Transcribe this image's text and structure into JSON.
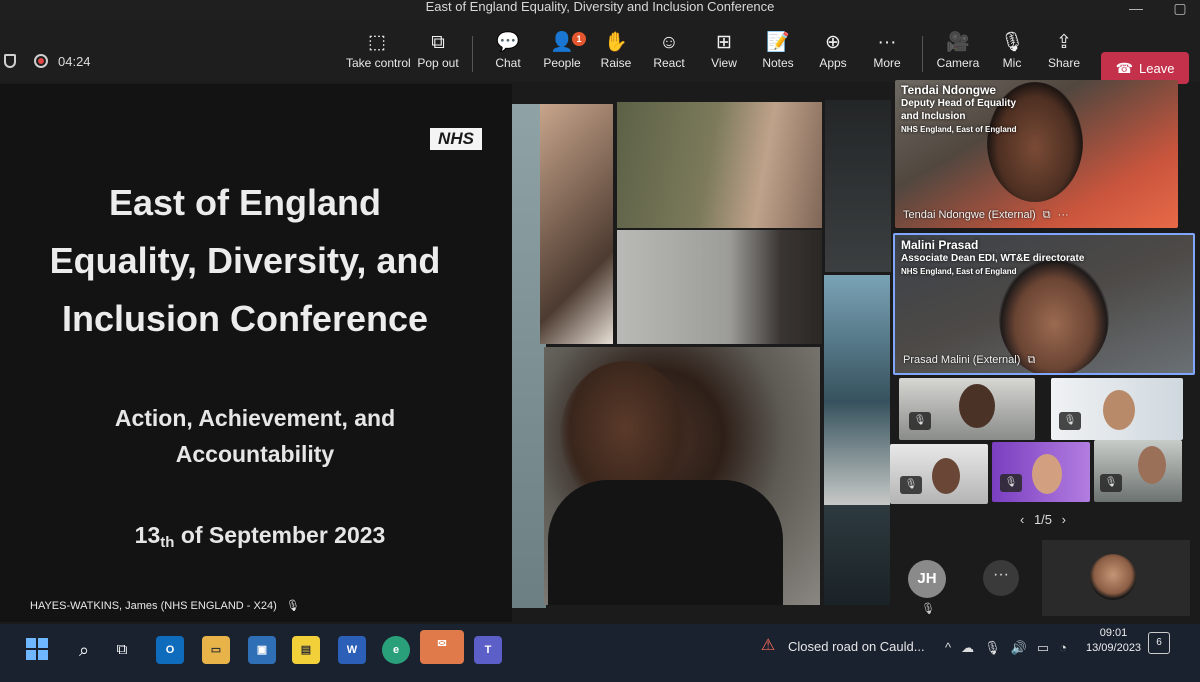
{
  "window": {
    "title": "East of England Equality, Diversity and Inclusion Conference"
  },
  "toolbar": {
    "timer": "04:24",
    "buttons": [
      {
        "label": "Take control",
        "icon": "take-control-icon"
      },
      {
        "label": "Pop out",
        "icon": "pop-out-icon"
      },
      {
        "label": "Chat",
        "icon": "chat-icon"
      },
      {
        "label": "People",
        "icon": "people-icon",
        "badge": "1"
      },
      {
        "label": "Raise",
        "icon": "raise-hand-icon"
      },
      {
        "label": "React",
        "icon": "react-icon"
      },
      {
        "label": "View",
        "icon": "view-icon"
      },
      {
        "label": "Notes",
        "icon": "notes-icon"
      },
      {
        "label": "Apps",
        "icon": "apps-icon"
      },
      {
        "label": "More",
        "icon": "more-icon"
      },
      {
        "label": "Camera",
        "icon": "camera-off-icon"
      },
      {
        "label": "Mic",
        "icon": "mic-off-icon"
      },
      {
        "label": "Share",
        "icon": "share-icon"
      }
    ],
    "leave_label": "Leave"
  },
  "slide": {
    "logo": "NHS",
    "title_lines": [
      "East of England",
      "Equality, Diversity, and",
      "Inclusion Conference"
    ],
    "subtitle_lines": [
      "Action, Achievement, and",
      "Accountability"
    ],
    "date_day": "13",
    "date_suffix": "th",
    "date_rest": "of September 2023",
    "presenter_name": "HAYES-WATKINS, James (NHS ENGLAND - X24)"
  },
  "participants": {
    "tendai": {
      "overlay_name": "Tendai Ndongwe",
      "overlay_role_1": "Deputy Head of Equality",
      "overlay_role_2": "and Inclusion",
      "overlay_org": "NHS England, East of England",
      "label": "Tendai Ndongwe (External)"
    },
    "malini": {
      "overlay_name": "Malini Prasad",
      "overlay_role": "Associate Dean EDI, WT&E directorate",
      "overlay_org": "NHS England, East of England",
      "label": "Prasad Malini (External)"
    },
    "pager": "1/5",
    "avatar_initials": "JH"
  },
  "taskbar": {
    "notification": "Closed road on Cauld...",
    "time": "09:01",
    "date": "13/09/2023",
    "notification_count": "6"
  }
}
